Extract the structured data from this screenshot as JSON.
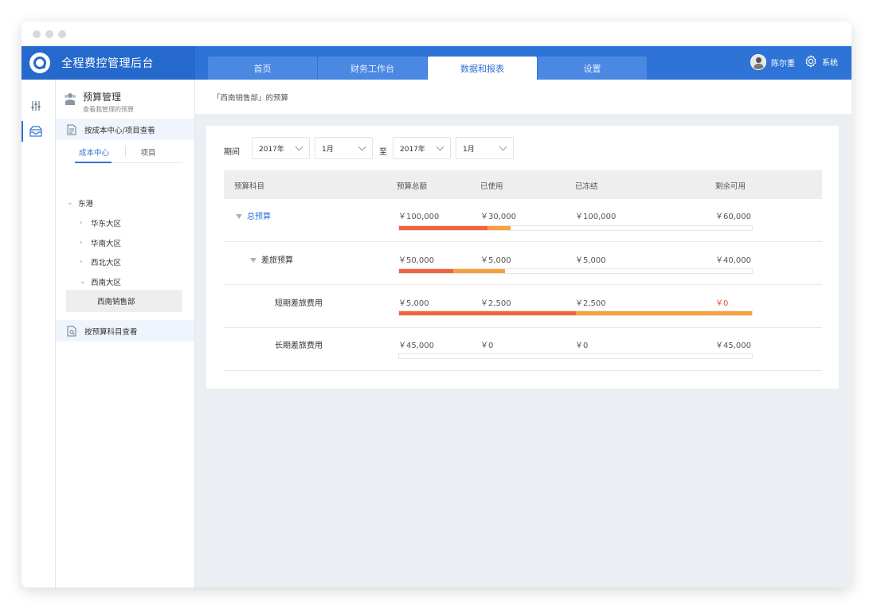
{
  "app": {
    "title": "全程费控管理后台"
  },
  "nav": {
    "tabs": [
      {
        "label": "首页"
      },
      {
        "label": "财务工作台"
      },
      {
        "label": "数据和报表"
      },
      {
        "label": "设置"
      }
    ],
    "active_tab": "数据和报表"
  },
  "user": {
    "name": "陈尔重"
  },
  "system": {
    "label": "系统"
  },
  "sidebar": {
    "title": "预算管理",
    "subtitle": "查看我管理的预算",
    "view_by_cost_center": "按成本中心/项目查看",
    "segments": [
      {
        "label": "成本中心"
      },
      {
        "label": "项目"
      }
    ],
    "tree": [
      {
        "label": "东港",
        "expanded": true
      },
      {
        "label": "华东大区",
        "expanded": false
      },
      {
        "label": "华南大区",
        "expanded": false
      },
      {
        "label": "西北大区",
        "expanded": false
      },
      {
        "label": "西南大区",
        "expanded": true
      }
    ],
    "selected": "西南销售部",
    "view_by_subject": "按预算科目查看"
  },
  "breadcrumb": "「西南销售部」的预算",
  "filter": {
    "label": "期间",
    "to_label": "至",
    "from_year": "2017年",
    "from_month": "1月",
    "to_year": "2017年",
    "to_month": "1月"
  },
  "table": {
    "headers": [
      "预算科目",
      "预算总额",
      "已使用",
      "已冻结",
      "剩余可用"
    ],
    "rows": [
      {
        "name": "总预算",
        "total": "￥100,000",
        "used": "￥30,000",
        "frozen": "￥100,000",
        "remaining": "￥60,000",
        "used_ratio": 0.25,
        "frozen_ratio": 0.065
      },
      {
        "name": "差旅预算",
        "total": "￥50,000",
        "used": "￥5,000",
        "frozen": "￥5,000",
        "remaining": "￥40,000",
        "used_ratio": 0.153,
        "frozen_ratio": 0.147
      },
      {
        "name": "短期差旅费用",
        "total": "￥5,000",
        "used": "￥2,500",
        "frozen": "￥2,500",
        "remaining": "￥0",
        "used_ratio": 0.5,
        "frozen_ratio": 0.5
      },
      {
        "name": "长期差旅费用",
        "total": "￥45,000",
        "used": "￥0",
        "frozen": "￥0",
        "remaining": "￥45,000",
        "used_ratio": 0,
        "frozen_ratio": 0
      }
    ]
  },
  "colors": {
    "primary": "#2e73d6",
    "used_bar": "#f7623b",
    "frozen_bar": "#f9a13e",
    "negative": "#f5493d"
  },
  "icons": [
    "settings-sliders-icon",
    "inbox-icon",
    "group-icon",
    "document-icon",
    "document-search-icon",
    "gear-icon",
    "avatar-icon"
  ]
}
